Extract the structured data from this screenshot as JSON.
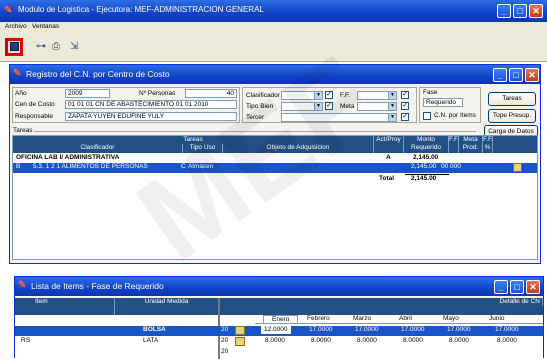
{
  "app": {
    "title": "Modulo de Logistica - Ejecutora: MEF-ADMINISTRACION GENERAL",
    "menu": [
      "Archivo",
      "Ventanas"
    ]
  },
  "toolbar": {
    "icons": [
      "save-icon",
      "link-icon",
      "print-icon",
      "exit-icon"
    ]
  },
  "watermark": "MEF",
  "registro": {
    "title": "Registro del C.N. por Centro de Costo",
    "anio_label": "Año",
    "anio_value": "2009",
    "nro_pers_label": "Nº Personas",
    "nro_pers_value": "40",
    "centro_costo_label": "Cen de Costo",
    "centro_costo_value": "01 01 01 CN  DE ABASTECIMIENTO 01 01 2010",
    "responsable_label": "Responsable",
    "responsable_value": "ZAPATA YUYEN EDUFINE YULY",
    "filters": {
      "clasificador_label": "Clasificador",
      "tipo_bien_label": "Tipo Bien",
      "tercer_label": "Tercer",
      "ff_label": "F.F.",
      "meta_label": "Meta"
    },
    "fase_label": "Fase",
    "fase_value": "Requerido",
    "cn_items_label": "C.N. por Items",
    "buttons": [
      "Tareas",
      "Tope Presup.",
      "Carga de Datos"
    ],
    "tareas_section": "Tareas",
    "grid": {
      "headers_top": [
        "Tareas",
        "Act/Proy",
        "Monto Requerido",
        "F.F.",
        "Meta",
        "F.F."
      ],
      "headers_bottom": [
        "Clasificador",
        "Tipo Uso",
        "Objeto de Adquisicion",
        "Prod.",
        "%"
      ],
      "rows": [
        {
          "code": "OFICINA LAB I/ ADMINISTRATIVA",
          "desc": "",
          "tipo": "",
          "obj": "",
          "act": "A",
          "monto": "2,145.00",
          "extra": ""
        },
        {
          "code": "B",
          "desc": "5.3. 1 2 1   ALIMENTOS DE PERSONAS",
          "tipo": "C",
          "obj": "Almacen",
          "act": "",
          "monto": "2,145.00",
          "extra": "00  000"
        }
      ],
      "total_label": "Total",
      "total_value": "2,145.00"
    }
  },
  "lista": {
    "title": "Lista de Items - Fase de Requerido",
    "headers": [
      "Item",
      "Unidad Medida"
    ],
    "detalle_label": "Detalle de CN",
    "months": [
      "Enero",
      "Febrero",
      "Marzo",
      "Abril",
      "Mayo",
      "Junio"
    ],
    "rows": [
      {
        "item": "",
        "unidad": "BOLSA",
        "qty": "20",
        "values": [
          "12.0000",
          "17.0000",
          "17.0000",
          "17.0000",
          "17.0000",
          "17.0000"
        ]
      },
      {
        "item": "RS",
        "unidad": "LATA",
        "qty": "20",
        "values": [
          "8.0000",
          "8.0000",
          "8.0000",
          "8.0000",
          "8.0000",
          "8.0000"
        ]
      },
      {
        "item": "",
        "unidad": "",
        "qty": "20",
        "values": []
      }
    ]
  }
}
